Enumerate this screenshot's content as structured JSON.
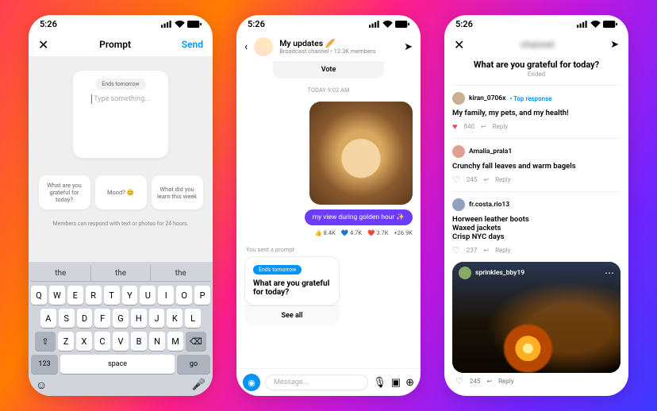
{
  "status": {
    "time": "5:26"
  },
  "s1": {
    "title": "Prompt",
    "send": "Send",
    "ends": "Ends tomorrow",
    "placeholder": "Type something...",
    "sug1": "What are you grateful for today?",
    "sug2": "Mood? 😊",
    "sug3": "What did you learn this week",
    "hint": "Members can respond with text or photos for 24 hours.",
    "predict": "the",
    "keys_r1": [
      "Q",
      "W",
      "E",
      "R",
      "T",
      "Y",
      "U",
      "I",
      "O",
      "P"
    ],
    "keys_r2": [
      "A",
      "S",
      "D",
      "F",
      "G",
      "H",
      "J",
      "K",
      "L"
    ],
    "keys_r3": [
      "Z",
      "X",
      "C",
      "V",
      "B",
      "N",
      "M"
    ],
    "k123": "123",
    "kspace": "space",
    "kgo": "go"
  },
  "s2": {
    "title": "My updates 🥖",
    "sub": "Broadcast channel • 12.3K members",
    "vote": "Vote",
    "time": "TODAY 9:02 AM",
    "caption": "my view during golden hour ✨",
    "r1": "👍 8.4K",
    "r2": "💙 4.7K",
    "r3": "❤️ 3.7K",
    "r4": "+26.9K",
    "yousent": "You sent a prompt",
    "ends": "Ends tomorrow",
    "prompt": "What are you grateful for today?",
    "seeall": "See all",
    "msg_ph": "Message..."
  },
  "s3": {
    "title": "What are you grateful for today?",
    "ended": "Ended",
    "reply": "Reply",
    "top": "Top response",
    "r1_user": "kiran_0706x",
    "r1_text": "My family, my pets, and my health!",
    "r1_likes": "840",
    "r2_user": "Amalia_prala1",
    "r2_text": "Crunchy fall leaves and warm bagels",
    "r2_likes": "245",
    "r3_user": "fr.costa.rio13",
    "r3_text": "Horween leather boots\nWaxed jackets\nCrisp NYC days",
    "r3_likes": "237",
    "r4_user": "sprinkles_bby19",
    "r4_likes": "245"
  }
}
